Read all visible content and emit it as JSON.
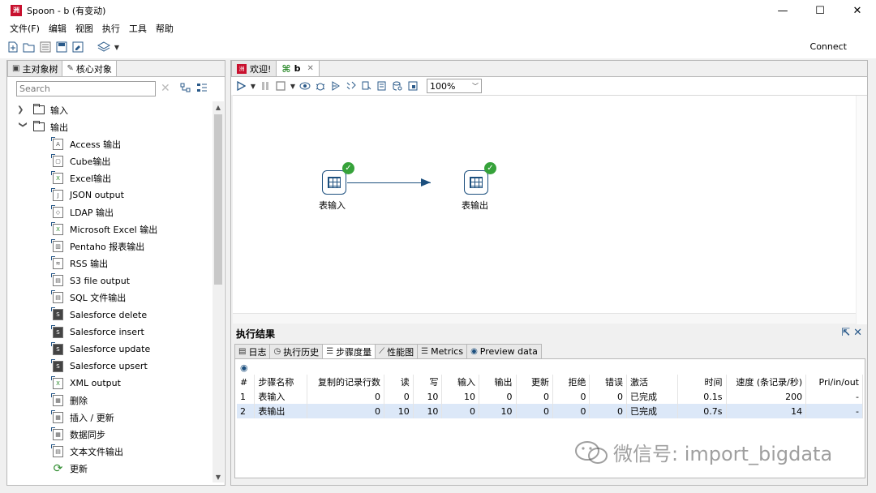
{
  "window": {
    "title": "Spoon - b (有变动)",
    "logo_text": "洲",
    "minimize": "—",
    "maximize": "☐",
    "close": "✕"
  },
  "menu": [
    "文件(F)",
    "编辑",
    "视图",
    "执行",
    "工具",
    "帮助"
  ],
  "toolbar": {
    "connect_label": "Connect"
  },
  "left_panel": {
    "tabs": [
      {
        "label": "主对象树",
        "icon": "tree-icon"
      },
      {
        "label": "核心对象",
        "icon": "pencil-icon"
      }
    ],
    "search_placeholder": "Search",
    "tree": {
      "folders": [
        {
          "label": "输入",
          "expanded": false
        },
        {
          "label": "输出",
          "expanded": true
        }
      ],
      "output_items": [
        {
          "label": "Access 输出",
          "icon": "A"
        },
        {
          "label": "Cube输出",
          "icon": "▢"
        },
        {
          "label": "Excel输出",
          "icon": "X"
        },
        {
          "label": "JSON output",
          "icon": "J"
        },
        {
          "label": "LDAP 输出",
          "icon": "◇"
        },
        {
          "label": "Microsoft Excel 输出",
          "icon": "X"
        },
        {
          "label": "Pentaho 报表输出",
          "icon": "▥"
        },
        {
          "label": "RSS 输出",
          "icon": "≋"
        },
        {
          "label": "S3 file output",
          "icon": "▤"
        },
        {
          "label": "SQL 文件输出",
          "icon": "▤"
        },
        {
          "label": "Salesforce delete",
          "icon": "S"
        },
        {
          "label": "Salesforce insert",
          "icon": "S"
        },
        {
          "label": "Salesforce update",
          "icon": "S"
        },
        {
          "label": "Salesforce upsert",
          "icon": "S"
        },
        {
          "label": "XML output",
          "icon": "X"
        },
        {
          "label": "删除",
          "icon": "▦"
        },
        {
          "label": "插入 / 更新",
          "icon": "▦"
        },
        {
          "label": "数据同步",
          "icon": "▦"
        },
        {
          "label": "文本文件输出",
          "icon": "▤"
        },
        {
          "label": "更新",
          "icon": "⟳"
        }
      ]
    }
  },
  "right_panel": {
    "tabs": [
      {
        "label": "欢迎!",
        "active": false
      },
      {
        "label": "b",
        "active": true
      }
    ],
    "zoom": "100%",
    "steps": [
      {
        "label": "表输入"
      },
      {
        "label": "表输出"
      }
    ],
    "results": {
      "title": "执行结果",
      "tabs": [
        "日志",
        "执行历史",
        "步骤度量",
        "性能图",
        "Metrics",
        "Preview data"
      ],
      "active_tab": "步骤度量",
      "columns": [
        "#",
        "步骤名称",
        "复制的记录行数",
        "读",
        "写",
        "输入",
        "输出",
        "更新",
        "拒绝",
        "错误",
        "激活",
        "时间",
        "速度 (条记录/秒)",
        "Pri/in/out"
      ],
      "rows": [
        [
          "1",
          "表输入",
          "0",
          "0",
          "10",
          "10",
          "0",
          "0",
          "0",
          "0",
          "已完成",
          "0.1s",
          "200",
          "-"
        ],
        [
          "2",
          "表输出",
          "0",
          "10",
          "10",
          "0",
          "10",
          "0",
          "0",
          "0",
          "已完成",
          "0.7s",
          "14",
          "-"
        ]
      ]
    }
  },
  "watermark": "微信号: import_bigdata"
}
